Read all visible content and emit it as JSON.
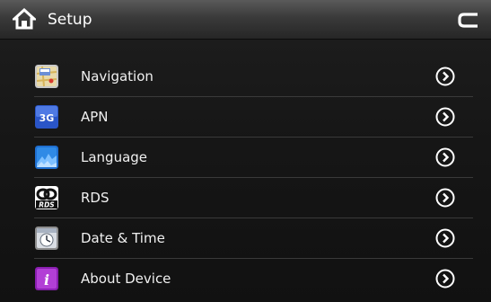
{
  "header": {
    "title": "Setup",
    "home_icon": "home-icon",
    "back_icon": "back-arrow-icon"
  },
  "menu": {
    "items": [
      {
        "label": "Navigation",
        "icon": "navigation-map-icon"
      },
      {
        "label": "APN",
        "icon": "apn-3g-icon"
      },
      {
        "label": "Language",
        "icon": "language-icon"
      },
      {
        "label": "RDS",
        "icon": "rds-icon"
      },
      {
        "label": "Date & Time",
        "icon": "date-time-icon"
      },
      {
        "label": "About Device",
        "icon": "about-device-icon"
      }
    ]
  },
  "colors": {
    "background": "#121212",
    "header_top": "#5a5a5a",
    "header_bottom": "#262626",
    "divider": "#3a3a3a",
    "text": "#ffffff"
  }
}
